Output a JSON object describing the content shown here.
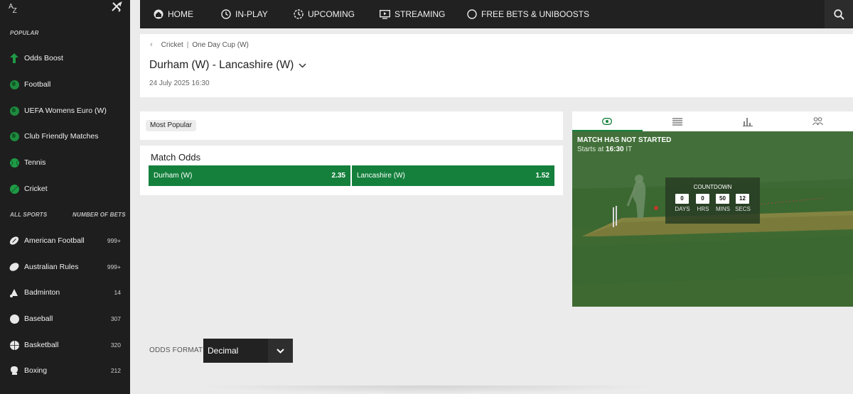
{
  "sidebar": {
    "az_top": "A",
    "az_bottom": "Z",
    "popular_title": "POPULAR",
    "popular": [
      {
        "label": "Odds Boost",
        "icon": "arrow-boost-icon"
      },
      {
        "label": "Football",
        "icon": "globe-icon"
      },
      {
        "label": "UEFA Womens Euro (W)",
        "icon": "globe-icon"
      },
      {
        "label": "Club Friendly Matches",
        "icon": "globe-icon"
      },
      {
        "label": "Tennis",
        "icon": "tennis-ball-icon"
      },
      {
        "label": "Cricket",
        "icon": "cricket-ball-icon"
      }
    ],
    "all_sports_title": "ALL SPORTS",
    "number_of_bets_title": "NUMBER OF BETS",
    "sports": [
      {
        "label": "American Football",
        "count": "999+",
        "icon": "american-football-icon"
      },
      {
        "label": "Australian Rules",
        "count": "999+",
        "icon": "rugby-ball-icon"
      },
      {
        "label": "Badminton",
        "count": "14",
        "icon": "shuttlecock-icon"
      },
      {
        "label": "Baseball",
        "count": "307",
        "icon": "baseball-icon"
      },
      {
        "label": "Basketball",
        "count": "320",
        "icon": "basketball-icon"
      },
      {
        "label": "Boxing",
        "count": "212",
        "icon": "boxing-glove-icon"
      }
    ]
  },
  "nav": {
    "items": [
      {
        "label": "HOME",
        "icon": "home-icon"
      },
      {
        "label": "IN-PLAY",
        "icon": "clock-icon"
      },
      {
        "label": "UPCOMING",
        "icon": "upcoming-icon"
      },
      {
        "label": "STREAMING",
        "icon": "tv-icon"
      },
      {
        "label": "FREE BETS & UNIBOOSTS",
        "icon": "circle-icon"
      }
    ]
  },
  "event": {
    "breadcrumb": [
      "Cricket",
      "One Day Cup (W)"
    ],
    "breadcrumb_sep": "|",
    "title": "Durham (W) - Lancashire (W)",
    "date": "24 July 2025 16:30"
  },
  "filter": {
    "selected": "Most Popular"
  },
  "match_odds": {
    "title": "Match Odds",
    "selections": [
      {
        "name": "Durham (W)",
        "price": "2.35"
      },
      {
        "name": "Lancashire (W)",
        "price": "1.52"
      }
    ]
  },
  "visualisation": {
    "status": "MATCH HAS NOT STARTED",
    "starts_prefix": "Starts at ",
    "starts_time": "16:30",
    "starts_suffix": " IT",
    "countdown": {
      "title": "COUNTDOWN",
      "days": "0",
      "hrs": "0",
      "mins": "50",
      "secs": "12",
      "days_label": "DAYS",
      "hrs_label": "HRS",
      "mins_label": "MINS",
      "secs_label": "SECS"
    }
  },
  "odds_format": {
    "label": "ODDS FORMAT",
    "value": "Decimal"
  },
  "colors": {
    "accent": "#14803c",
    "sidebar_bg": "#1e1e1e",
    "nav_bg": "#212121",
    "pitch": "#3d6b31"
  }
}
